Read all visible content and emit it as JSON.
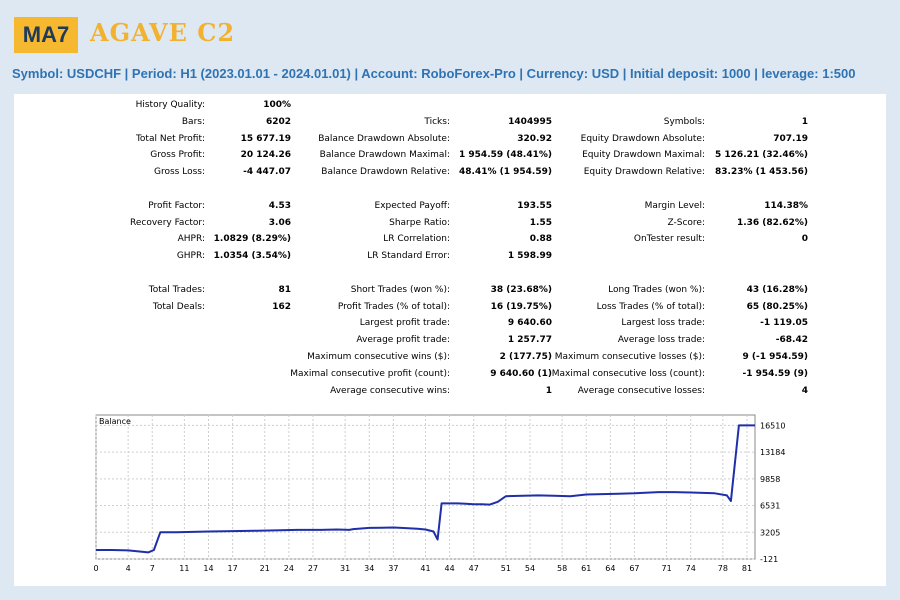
{
  "header": {
    "logo_badge": "MA7",
    "logo_text": "AGAVE C2",
    "info_line": "Symbol: USDCHF  |  Period: H1 (2023.01.01 - 2024.01.01)  |  Account: RoboForex-Pro  |  Currency: USD  | Initial deposit: 1000  |  leverage: 1:500"
  },
  "stats": {
    "col1": [
      {
        "label": "History Quality:",
        "value": "100%"
      },
      {
        "label": "Bars:",
        "value": "6202"
      },
      {
        "label": "Total Net Profit:",
        "value": "15 677.19"
      },
      {
        "label": "Gross Profit:",
        "value": "20 124.26"
      },
      {
        "label": "Gross Loss:",
        "value": "-4 447.07"
      },
      {
        "label": "Profit Factor:",
        "value": "4.53"
      },
      {
        "label": "Recovery Factor:",
        "value": "3.06"
      },
      {
        "label": "AHPR:",
        "value": "1.0829 (8.29%)"
      },
      {
        "label": "GHPR:",
        "value": "1.0354 (3.54%)"
      },
      {
        "label": "Total Trades:",
        "value": "81"
      },
      {
        "label": "Total Deals:",
        "value": "162"
      }
    ],
    "col2": [
      {
        "label": "Ticks:",
        "value": "1404995"
      },
      {
        "label": "Balance Drawdown Absolute:",
        "value": "320.92"
      },
      {
        "label": "Balance Drawdown Maximal:",
        "value": "1 954.59 (48.41%)"
      },
      {
        "label": "Balance Drawdown Relative:",
        "value": "48.41% (1 954.59)"
      },
      {
        "label": "Expected Payoff:",
        "value": "193.55"
      },
      {
        "label": "Sharpe Ratio:",
        "value": "1.55"
      },
      {
        "label": "LR Correlation:",
        "value": "0.88"
      },
      {
        "label": "LR Standard Error:",
        "value": "1 598.99"
      },
      {
        "label": "Short Trades (won %):",
        "value": "38 (23.68%)"
      },
      {
        "label": "Profit Trades (% of total):",
        "value": "16 (19.75%)"
      },
      {
        "label": "Largest profit trade:",
        "value": "9 640.60"
      },
      {
        "label": "Average profit trade:",
        "value": "1 257.77"
      },
      {
        "label": "Maximum consecutive wins ($):",
        "value": "2 (177.75)"
      },
      {
        "label": "Maximal consecutive profit (count):",
        "value": "9 640.60 (1)"
      },
      {
        "label": "Average consecutive wins:",
        "value": "1"
      }
    ],
    "col3": [
      {
        "label": "Symbols:",
        "value": "1"
      },
      {
        "label": "Equity Drawdown Absolute:",
        "value": "707.19"
      },
      {
        "label": "Equity Drawdown Maximal:",
        "value": "5 126.21 (32.46%)"
      },
      {
        "label": "Equity Drawdown Relative:",
        "value": "83.23% (1 453.56)"
      },
      {
        "label": "Margin Level:",
        "value": "114.38%"
      },
      {
        "label": "Z-Score:",
        "value": "1.36 (82.62%)"
      },
      {
        "label": "OnTester result:",
        "value": "0"
      },
      {
        "label": "Long Trades (won %):",
        "value": "43 (16.28%)"
      },
      {
        "label": "Loss Trades (% of total):",
        "value": "65 (80.25%)"
      },
      {
        "label": "Largest loss trade:",
        "value": "-1 119.05"
      },
      {
        "label": "Average loss trade:",
        "value": "-68.42"
      },
      {
        "label": "Maximum consecutive losses ($):",
        "value": "9 (-1 954.59)"
      },
      {
        "label": "Maximal consecutive loss (count):",
        "value": "-1 954.59 (9)"
      },
      {
        "label": "Average consecutive losses:",
        "value": "4"
      }
    ]
  },
  "chart_data": {
    "type": "line",
    "title": "Balance",
    "line_color": "#1f2fa8",
    "grid": true,
    "xlim": [
      0,
      82
    ],
    "ylim": [
      -121,
      17800
    ],
    "x_ticks": [
      "0",
      "4",
      "7",
      "11",
      "14",
      "17",
      "21",
      "24",
      "27",
      "31",
      "34",
      "37",
      "41",
      "44",
      "47",
      "51",
      "54",
      "58",
      "61",
      "64",
      "67",
      "71",
      "74",
      "78",
      "81"
    ],
    "y_ticks": [
      "-121",
      "3205",
      "6531",
      "9858",
      "13184",
      "16510"
    ],
    "series": [
      {
        "x": [
          0,
          2,
          4,
          6.5,
          7.2,
          8,
          10,
          14,
          17,
          20,
          23,
          25,
          28,
          30,
          31.5,
          32,
          34,
          37,
          38,
          40,
          41,
          42,
          42.5,
          43,
          45,
          46,
          47,
          48,
          49,
          50,
          51,
          55,
          57,
          59,
          61,
          63,
          65,
          67,
          68,
          70,
          72,
          74,
          75.5,
          77,
          78.5,
          79,
          80,
          81,
          82
        ],
        "y": [
          1000,
          1000,
          950,
          700,
          1000,
          3200,
          3200,
          3300,
          3350,
          3400,
          3450,
          3500,
          3500,
          3550,
          3500,
          3600,
          3750,
          3800,
          3750,
          3650,
          3550,
          3300,
          2300,
          6800,
          6800,
          6750,
          6700,
          6700,
          6650,
          7000,
          7700,
          7800,
          7750,
          7700,
          7900,
          7950,
          8000,
          8050,
          8100,
          8200,
          8200,
          8150,
          8100,
          8050,
          7800,
          7100,
          16500,
          16510,
          16500
        ]
      }
    ]
  }
}
